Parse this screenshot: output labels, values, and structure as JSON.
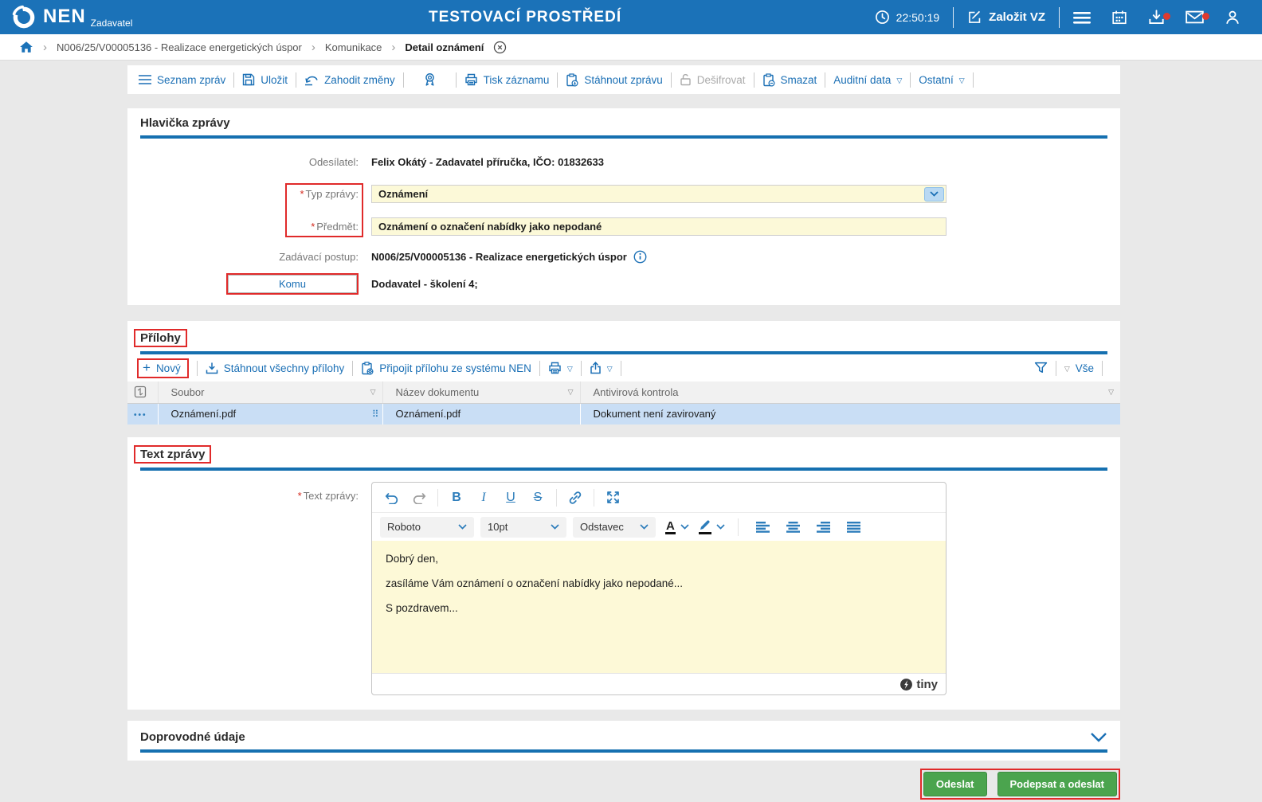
{
  "brand": {
    "name": "NEN",
    "role": "Zadavatel",
    "env_title": "TESTOVACÍ PROSTŘEDÍ",
    "time": "22:50:19",
    "create_vz": "Založit VZ"
  },
  "breadcrumb": {
    "item1": "N006/25/V00005136 - Realizace energetických úspor",
    "item2": "Komunikace",
    "item3": "Detail oznámení"
  },
  "toolbar": {
    "seznam": "Seznam zpráv",
    "ulozit": "Uložit",
    "zahodit": "Zahodit změny",
    "tisk": "Tisk záznamu",
    "stahnout": "Stáhnout zprávu",
    "desifrovat": "Dešifrovat",
    "smazat": "Smazat",
    "auditni": "Auditní data",
    "ostatni": "Ostatní"
  },
  "hlavicka": {
    "title": "Hlavička zprávy",
    "odesilatel_label": "Odesílatel:",
    "odesilatel_value": "Felix Okátý - Zadavatel příručka, IČO: 01832633",
    "typ_label": "Typ zprávy:",
    "typ_value": "Oznámení",
    "predmet_label": "Předmět:",
    "predmet_value": "Oznámení o označení nabídky jako nepodané",
    "postup_label": "Zadávací postup:",
    "postup_value": "N006/25/V00005136 - Realizace energetických úspor",
    "komu_label": "Komu",
    "komu_value": "Dodavatel - školení 4;"
  },
  "prilohy": {
    "title": "Přílohy",
    "novy": "Nový",
    "stahnout_vse": "Stáhnout všechny přílohy",
    "pripojit": "Připojit přílohu ze systému NEN",
    "vse": "Vše",
    "col_soubor": "Soubor",
    "col_nazev": "Název dokumentu",
    "col_antivir": "Antivirová kontrola",
    "row": {
      "soubor": "Oznámení.pdf",
      "nazev": "Oznámení.pdf",
      "antivir": "Dokument není zavirovaný"
    }
  },
  "text_zpravy": {
    "title": "Text zprávy",
    "label": "Text zprávy:",
    "font_name": "Roboto",
    "font_size": "10pt",
    "block_type": "Odstavec",
    "line1": "Dobrý den,",
    "line2": "zasíláme Vám oznámení o označení nabídky jako nepodané...",
    "line3": "S pozdravem...",
    "tiny_brand": "tiny"
  },
  "doprovodne": {
    "title": "Doprovodné údaje"
  },
  "footer": {
    "odeslat": "Odeslat",
    "podepsat": "Podepsat a odeslat"
  },
  "ui": {
    "required": "*"
  },
  "icons": {
    "plus": "+",
    "filter_tri": "▽",
    "crumb_sep": "›",
    "dots_h": "•••",
    "drag_dots": "⠿"
  },
  "colors": {
    "header_blue": "#1b72b8",
    "link_blue": "#1a6fb5",
    "underline_blue": "#1670b0",
    "field_yellow": "#fcf9d8",
    "button_green": "#4ba44e",
    "annotation_red": "#e02a2a",
    "row_selected": "#c9def5"
  }
}
